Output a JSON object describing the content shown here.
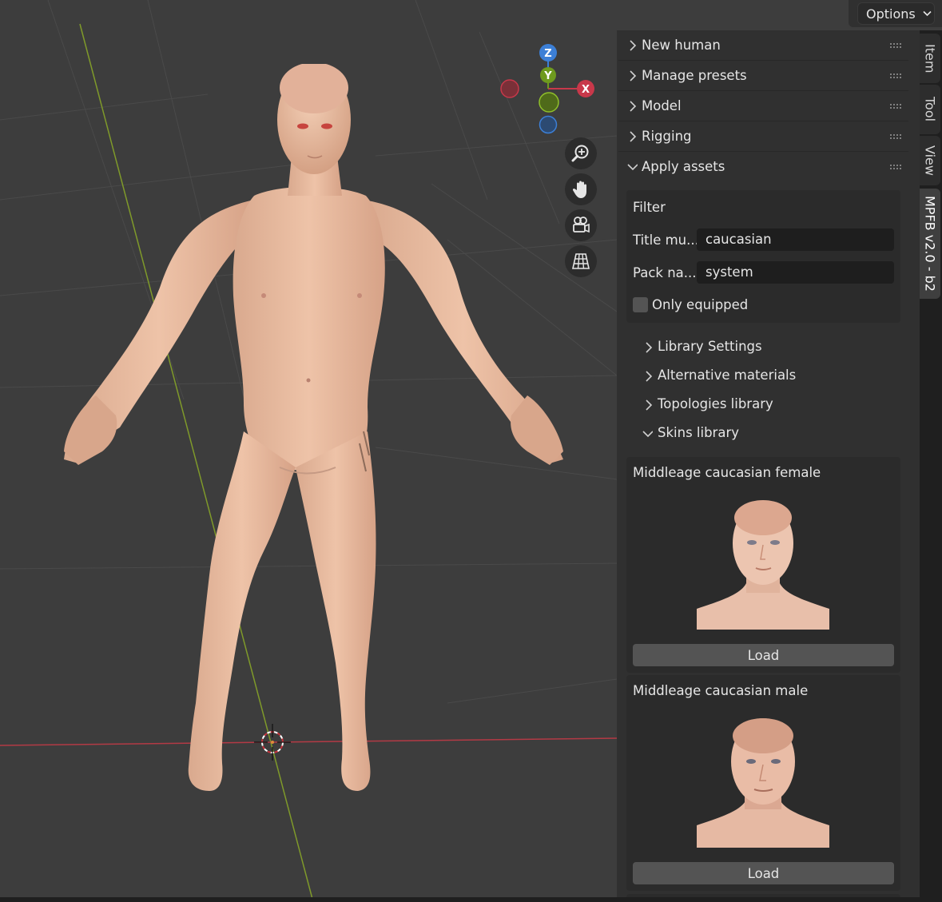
{
  "header": {
    "options_label": "Options"
  },
  "viewport": {
    "gizmo": {
      "z_label": "Z",
      "y_label": "Y",
      "x_label": "X"
    },
    "nav_icons": [
      "zoom-icon",
      "hand-pan-icon",
      "camera-icon",
      "grid-perspective-icon"
    ],
    "colors": {
      "background": "#3d3d3d",
      "x_axis": "#c8384a",
      "y_axis": "#6e9a1e",
      "z_axis": "#3c7fd6"
    }
  },
  "sidebar": {
    "panels": [
      {
        "label": "New human",
        "expanded": false
      },
      {
        "label": "Manage presets",
        "expanded": false
      },
      {
        "label": "Model",
        "expanded": false
      },
      {
        "label": "Rigging",
        "expanded": false
      },
      {
        "label": "Apply assets",
        "expanded": true
      }
    ],
    "filter": {
      "title": "Filter",
      "title_label": "Title mu...",
      "title_value": "caucasian",
      "pack_label": "Pack na...",
      "pack_value": "system",
      "only_equipped_label": "Only equipped",
      "only_equipped": false
    },
    "subpanels": [
      {
        "label": "Library Settings",
        "expanded": false
      },
      {
        "label": "Alternative materials",
        "expanded": false
      },
      {
        "label": "Topologies library",
        "expanded": false
      },
      {
        "label": "Skins library",
        "expanded": true
      }
    ],
    "skins": [
      {
        "title": "Middleage caucasian female",
        "button": "Load"
      },
      {
        "title": "Middleage caucasian male",
        "button": "Load"
      }
    ]
  },
  "tabs": [
    {
      "label": "Item",
      "active": false
    },
    {
      "label": "Tool",
      "active": false
    },
    {
      "label": "View",
      "active": false
    },
    {
      "label": "MPFB v2.0 - b2",
      "active": true
    }
  ]
}
